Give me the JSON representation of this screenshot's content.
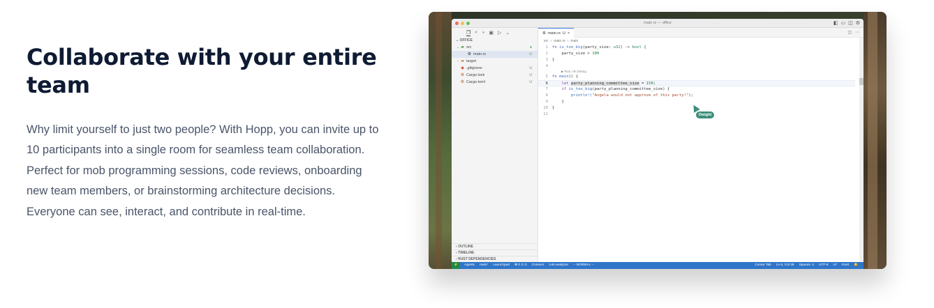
{
  "hero": {
    "headline": "Collaborate with your entire team",
    "body": "Why limit yourself to just two people? With Hopp, you can invite up to 10 participants into a single room for seamless team collaboration. Perfect for mob programming sessions, code reviews, onboarding new team members, or brainstorming architecture decisions. Everyone can see, interact, and contribute in real-time."
  },
  "ide": {
    "window_title": "main.rs — office",
    "explorer": {
      "section": "OFFICE",
      "items": [
        {
          "label": "src",
          "icon": "folder-open-icon",
          "mark": "●"
        },
        {
          "label": "main.rs",
          "icon": "rust-file-icon",
          "mark": "U"
        },
        {
          "label": "target",
          "icon": "folder-icon",
          "mark": ""
        },
        {
          "label": ".gitignore",
          "icon": "git-icon",
          "mark": "U"
        },
        {
          "label": "Cargo.lock",
          "icon": "cargo-icon",
          "mark": "U"
        },
        {
          "label": "Cargo.toml",
          "icon": "cargo-icon",
          "mark": "U"
        }
      ],
      "bottom_sections": [
        "OUTLINE",
        "TIMELINE",
        "RUST DEPENDENCIES"
      ]
    },
    "tab": {
      "label": "main.rs",
      "status": "U"
    },
    "breadcrumb": [
      "src",
      "main.rs",
      "main"
    ],
    "code": {
      "line_numbers": [
        "1",
        "2",
        "3",
        "4",
        "5",
        "6",
        "7",
        "8",
        "9",
        "10",
        "11"
      ],
      "line1": [
        "fn ",
        "is_too_big",
        "(party_size: ",
        "u32",
        ") -> ",
        "bool",
        " {"
      ],
      "line2": [
        "    party_size > ",
        "100"
      ],
      "line3": "}",
      "line4": "",
      "codelens": "▶ Run | ⚙ Debug",
      "line5": [
        "fn ",
        "main",
        "() {"
      ],
      "line6": [
        "    let ",
        "party_planning_committee_size",
        " = ",
        "150",
        ";"
      ],
      "line7": [
        "    if ",
        "is_too_big",
        "(party_planning_committee_size) {"
      ],
      "line8": [
        "        println!(",
        "\"Angela would not approve of this party!\"",
        ");"
      ],
      "line9": "    }",
      "line10": "}",
      "line11": ""
    },
    "remote_cursor": {
      "user": "Dwight",
      "color": "#3d8f7a"
    },
    "statusbar": {
      "left": [
        "Agents",
        "main*",
        "Launchpad",
        "⊗ 0 ⚠ 0",
        "Connect",
        "rust-analyzer",
        "-- NORMAL --"
      ],
      "right": [
        "Cursor Tab",
        "Ln 6, Col 28",
        "Spaces: 4",
        "UTF-8",
        "LF",
        "Rust"
      ]
    }
  }
}
